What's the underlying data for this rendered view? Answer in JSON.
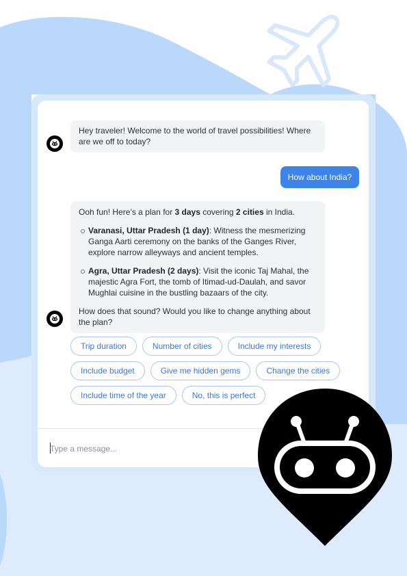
{
  "colors": {
    "background_blob": "#b9d8fb",
    "background_light": "#ddebfc",
    "user_bubble": "#3d83e8",
    "chip_text": "#3b78d8",
    "chip_border": "#aac6ee",
    "bot_bubble": "#f2f3f5",
    "pin": "#000000"
  },
  "icons": {
    "airplane": "airplane-icon",
    "bot_avatar": "robot-avatar-icon",
    "map_pin": "robot-map-pin-icon"
  },
  "chat": {
    "greeting": "Hey traveler! Welcome to the world of travel possibilities! Where are we off to today?",
    "user_reply": "How about India?",
    "plan": {
      "intro_pre": "Ooh fun! Here’s a plan for ",
      "intro_days": "3 days",
      "intro_mid": " covering ",
      "intro_cities": "2 cities",
      "intro_post": " in India.",
      "items": [
        {
          "title": "Varanasi, Uttar Pradesh (1 day)",
          "text": ": Witness the mesmerizing Ganga Aarti ceremony on the banks of the Ganges River, explore narrow alleyways and ancient temples."
        },
        {
          "title": "Agra, Uttar Pradesh (2 days)",
          "text": ": Visit the iconic Taj Mahal, the majestic Agra Fort, the tomb of Itimad-ud-Daulah, and savor Mughlai cuisine in the bustling bazaars of the city."
        }
      ],
      "closing": "How does that sound? Would you like to change anything about the plan?"
    }
  },
  "suggestions": {
    "row1": [
      "Trip duration",
      "Number of cities",
      "Include my interests"
    ],
    "row2": [
      "Include budget",
      "Give me hidden gems",
      "Change the cities"
    ],
    "row3": [
      "Include time of the year",
      "No, this is perfect"
    ]
  },
  "composer": {
    "placeholder": "Type a message...",
    "value": ""
  }
}
